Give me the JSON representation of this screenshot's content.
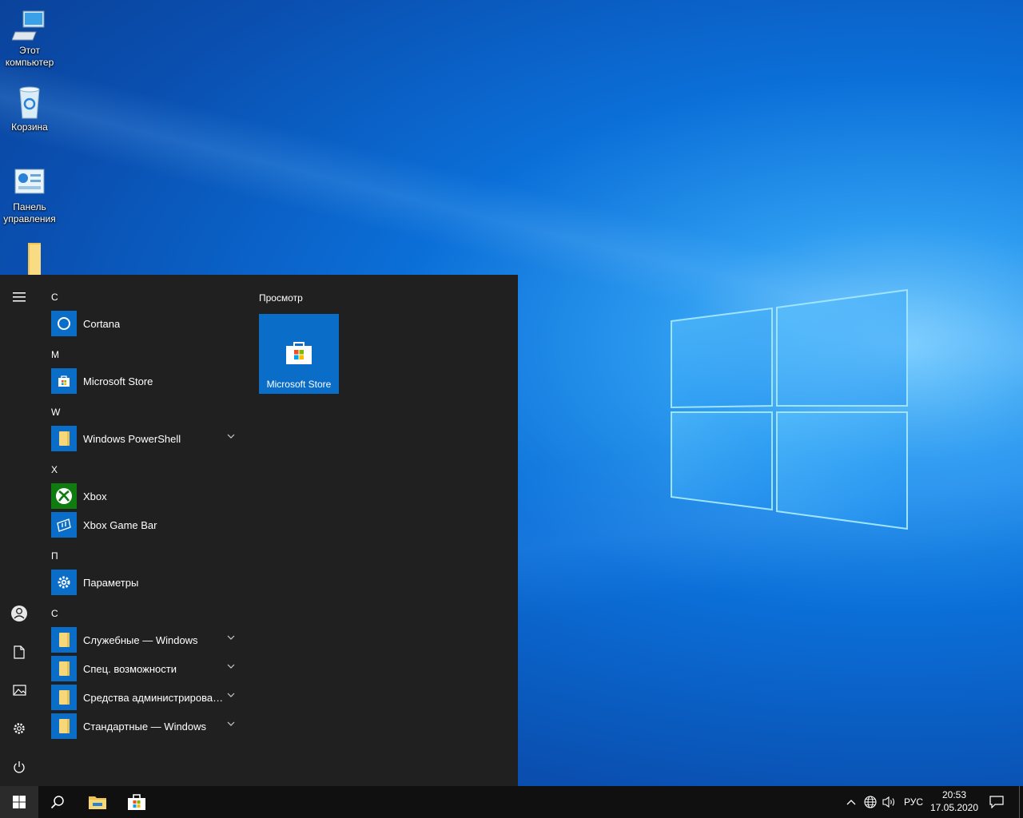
{
  "desktop": {
    "icons": [
      {
        "label_line1": "Этот",
        "label_line2": "компьютер",
        "icon": "computer-icon"
      },
      {
        "label_line1": "Корзина",
        "icon": "recycle-bin-icon"
      },
      {
        "label_line1": "Панель",
        "label_line2": "управления",
        "icon": "control-panel-icon"
      },
      {
        "icon": "folder-icon"
      }
    ]
  },
  "start_menu": {
    "sections": [
      {
        "letter": "C",
        "apps": [
          {
            "name": "Cortana",
            "icon": "cortana-icon"
          }
        ]
      },
      {
        "letter": "M",
        "apps": [
          {
            "name": "Microsoft Store",
            "icon": "store-icon"
          }
        ]
      },
      {
        "letter": "W",
        "apps": [
          {
            "name": "Windows PowerShell",
            "icon": "folder-icon",
            "expandable": true
          }
        ]
      },
      {
        "letter": "X",
        "apps": [
          {
            "name": "Xbox",
            "icon": "xbox-icon"
          },
          {
            "name": "Xbox Game Bar",
            "icon": "game-bar-icon"
          }
        ]
      },
      {
        "letter": "П",
        "apps": [
          {
            "name": "Параметры",
            "icon": "settings-gear-icon"
          }
        ]
      },
      {
        "letter": "С",
        "apps": [
          {
            "name": "Служебные — Windows",
            "icon": "folder-icon",
            "expandable": true
          },
          {
            "name": "Спец. возможности",
            "icon": "folder-icon",
            "expandable": true
          },
          {
            "name": "Средства администрирования…",
            "icon": "folder-icon",
            "expandable": true
          },
          {
            "name": "Стандартные — Windows",
            "icon": "folder-icon",
            "expandable": true
          }
        ]
      }
    ],
    "tiles_group_title": "Просмотр",
    "tiles": [
      {
        "name": "Microsoft Store",
        "icon": "store-icon"
      }
    ],
    "rail": [
      "hamburger-menu-icon",
      "user-icon",
      "documents-icon",
      "pictures-icon",
      "settings-icon",
      "power-icon"
    ]
  },
  "taskbar": {
    "pinned": [
      "start-icon",
      "search-icon",
      "file-explorer-icon",
      "store-icon"
    ],
    "language": "РУС",
    "time": "20:53",
    "date": "17.05.2020"
  },
  "colors": {
    "accent": "#0a6dc7",
    "menu_bg": "#202020",
    "taskbar_bg": "#101010",
    "xbox_green": "#107c10"
  }
}
